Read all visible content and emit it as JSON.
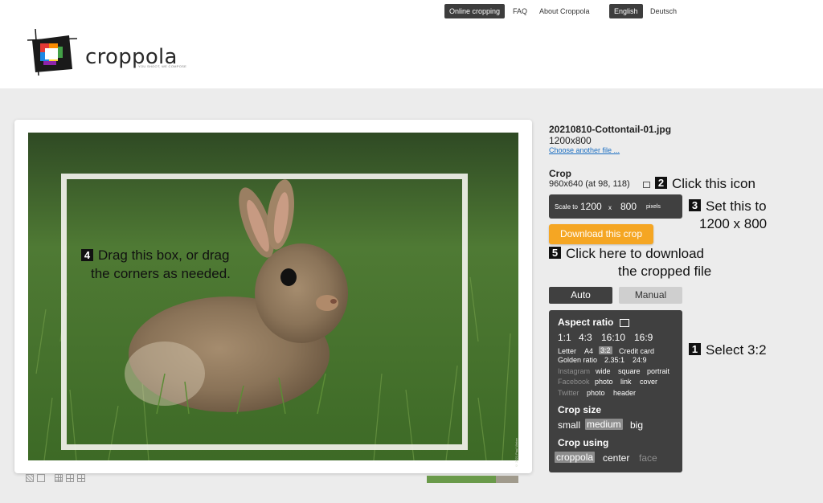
{
  "topnav": {
    "items": [
      "Online cropping",
      "FAQ",
      "About Croppola"
    ],
    "languages": [
      "English",
      "Deutsch"
    ]
  },
  "brand": {
    "name": "croppola",
    "tagline": "YOU SHOOT, WE COMPOSE",
    "logo_colors": [
      "#e53935",
      "#fb8c00",
      "#fdd835",
      "#43a047",
      "#1e88e5",
      "#8e24aa"
    ]
  },
  "photo": {
    "watermark": "© 2021 Paul Weber",
    "overlay_step": "4",
    "overlay_line1": "Drag this box, or drag",
    "overlay_line2": "the corners as needed."
  },
  "file": {
    "name": "20210810-Cottontail-01.jpg",
    "dimensions": "1200x800",
    "choose_link": "Choose another file ..."
  },
  "crop": {
    "label": "Crop",
    "info": "960x640 (at 98, 118)",
    "scale_label": "Scale to",
    "width": "1200",
    "times": "x",
    "height": "800",
    "unit": "pixels",
    "download": "Download this crop"
  },
  "mode": {
    "auto": "Auto",
    "manual": "Manual"
  },
  "options": {
    "aspect_title": "Aspect ratio",
    "ratios": [
      "1:1",
      "4:3",
      "16:10",
      "16:9"
    ],
    "paper": [
      "Letter",
      "A4",
      "3:2",
      "Credit card"
    ],
    "paper2": [
      "Golden ratio",
      "2.35:1",
      "24:9"
    ],
    "instagram": [
      "Instagram",
      "wide",
      "square",
      "portrait"
    ],
    "facebook": [
      "Facebook",
      "photo",
      "link",
      "cover"
    ],
    "twitter": [
      "Twitter",
      "photo",
      "header"
    ],
    "size_title": "Crop size",
    "sizes": [
      "small",
      "medium",
      "big"
    ],
    "using_title": "Crop using",
    "using": [
      "croppola",
      "center",
      "face"
    ]
  },
  "annotations": {
    "a2_num": "2",
    "a2": "Click this icon",
    "a3_num": "3",
    "a3_l1": "Set this to",
    "a3_l2": "1200 x 800",
    "a5_num": "5",
    "a5_l1": "Click here to download",
    "a5_l2": "the cropped file",
    "a1_num": "1",
    "a1": "Select 3:2"
  },
  "progress": {
    "fraction": 0.75
  }
}
